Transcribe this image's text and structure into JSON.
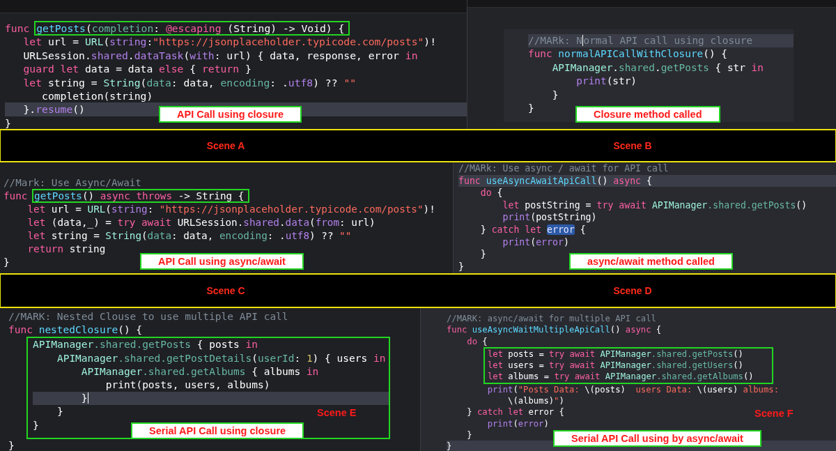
{
  "rows": [
    {
      "kind": "code",
      "panels": [
        {
          "lines": [
            {
              "kind": "line",
              "current": false,
              "tokens": [
                {
                  "text": "func ",
                  "kind": "kw"
                },
                {
                  "kind": "outlined",
                  "tokens": [
                    {
                      "text": "getPosts",
                      "kind": "decl"
                    },
                    {
                      "text": "(",
                      "kind": "plain"
                    },
                    {
                      "text": "completion",
                      "kind": "member"
                    },
                    {
                      "text": ": ",
                      "kind": "plain"
                    },
                    {
                      "text": "@escaping",
                      "kind": "kw"
                    },
                    {
                      "text": " (String) -> Void) {",
                      "kind": "plain"
                    }
                  ]
                }
              ]
            },
            {
              "kind": "line",
              "current": false,
              "tokens": [
                {
                  "text": "   let",
                  "kind": "kw"
                },
                {
                  "text": " url = ",
                  "kind": "plain"
                },
                {
                  "text": "URL",
                  "kind": "type"
                },
                {
                  "text": "(",
                  "kind": "plain"
                },
                {
                  "text": "string",
                  "kind": "sys"
                },
                {
                  "text": ":",
                  "kind": "plain"
                },
                {
                  "text": "\"https://jsonplaceholder.typicode.com/posts\"",
                  "kind": "str"
                },
                {
                  "text": ")!",
                  "kind": "plain"
                }
              ]
            },
            {
              "kind": "line",
              "current": false,
              "tokens": [
                {
                  "text": "   URLSession.",
                  "kind": "plain"
                },
                {
                  "text": "shared",
                  "kind": "sys"
                },
                {
                  "text": ".",
                  "kind": "plain"
                },
                {
                  "text": "dataTask",
                  "kind": "sys"
                },
                {
                  "text": "(",
                  "kind": "plain"
                },
                {
                  "text": "with",
                  "kind": "sys"
                },
                {
                  "text": ": url) { data, response, error ",
                  "kind": "plain"
                },
                {
                  "text": "in",
                  "kind": "kw"
                }
              ]
            },
            {
              "kind": "line",
              "current": false,
              "tokens": [
                {
                  "text": "   guard let",
                  "kind": "kw"
                },
                {
                  "text": " data = data ",
                  "kind": "plain"
                },
                {
                  "text": "else",
                  "kind": "kw"
                },
                {
                  "text": " { ",
                  "kind": "plain"
                },
                {
                  "text": "return",
                  "kind": "kw"
                },
                {
                  "text": " }",
                  "kind": "plain"
                }
              ]
            },
            {
              "kind": "line",
              "current": false,
              "tokens": [
                {
                  "text": "   let",
                  "kind": "kw"
                },
                {
                  "text": " string = ",
                  "kind": "plain"
                },
                {
                  "text": "String",
                  "kind": "type"
                },
                {
                  "text": "(",
                  "kind": "plain"
                },
                {
                  "text": "data",
                  "kind": "member"
                },
                {
                  "text": ": data, ",
                  "kind": "plain"
                },
                {
                  "text": "encoding",
                  "kind": "member"
                },
                {
                  "text": ": .",
                  "kind": "plain"
                },
                {
                  "text": "utf8",
                  "kind": "sys"
                },
                {
                  "text": ") ?? ",
                  "kind": "plain"
                },
                {
                  "text": "\"\"",
                  "kind": "str"
                }
              ]
            },
            {
              "kind": "line",
              "current": false,
              "tokens": [
                {
                  "text": "      completion(string)",
                  "kind": "plain"
                }
              ]
            },
            {
              "kind": "line",
              "current": true,
              "tokens": [
                {
                  "text": "   }.",
                  "kind": "plain"
                },
                {
                  "text": "resume",
                  "kind": "sys"
                },
                {
                  "text": "()",
                  "kind": "plain"
                }
              ]
            },
            {
              "kind": "line",
              "current": false,
              "tokens": [
                {
                  "text": "}",
                  "kind": "plain"
                }
              ]
            }
          ],
          "caption": "API Call using closure"
        },
        {
          "lines": [
            {
              "kind": "line",
              "current": true,
              "tokens": [
                {
                  "text": "//MARk: N",
                  "kind": "comment"
                },
                {
                  "kind": "caret"
                },
                {
                  "text": "ormal API call using closure",
                  "kind": "comment"
                }
              ]
            },
            {
              "kind": "line",
              "current": false,
              "tokens": [
                {
                  "text": "func ",
                  "kind": "kw"
                },
                {
                  "text": "normalAPICallWithClosure",
                  "kind": "decl"
                },
                {
                  "text": "() {",
                  "kind": "plain"
                }
              ]
            },
            {
              "kind": "line",
              "current": false,
              "tokens": [
                {
                  "text": "    APIManager",
                  "kind": "type"
                },
                {
                  "text": ".",
                  "kind": "plain"
                },
                {
                  "text": "shared",
                  "kind": "member"
                },
                {
                  "text": ".",
                  "kind": "plain"
                },
                {
                  "text": "getPosts",
                  "kind": "member"
                },
                {
                  "text": " { str ",
                  "kind": "plain"
                },
                {
                  "text": "in",
                  "kind": "kw"
                }
              ]
            },
            {
              "kind": "line",
              "current": false,
              "tokens": [
                {
                  "text": "        print",
                  "kind": "sys"
                },
                {
                  "text": "(str)",
                  "kind": "plain"
                }
              ]
            },
            {
              "kind": "line",
              "current": false,
              "tokens": [
                {
                  "text": "    }",
                  "kind": "plain"
                }
              ]
            },
            {
              "kind": "line",
              "current": false,
              "tokens": [
                {
                  "text": "}",
                  "kind": "plain"
                }
              ]
            }
          ],
          "caption": "Closure method called"
        }
      ]
    },
    {
      "kind": "banner",
      "labels": [
        "Scene A",
        "Scene B"
      ]
    },
    {
      "kind": "code",
      "panels": [
        {
          "lines": [
            {
              "kind": "line",
              "current": false,
              "tokens": [
                {
                  "text": "//Mark: Use Async/Await",
                  "kind": "comment"
                }
              ]
            },
            {
              "kind": "line",
              "current": false,
              "tokens": [
                {
                  "text": "func ",
                  "kind": "kw"
                },
                {
                  "kind": "outlined",
                  "tokens": [
                    {
                      "text": "getPosts",
                      "kind": "decl"
                    },
                    {
                      "text": "() ",
                      "kind": "plain"
                    },
                    {
                      "text": "async throws",
                      "kind": "kw"
                    },
                    {
                      "text": " -> String {",
                      "kind": "plain"
                    }
                  ]
                }
              ]
            },
            {
              "kind": "line",
              "current": false,
              "tokens": [
                {
                  "text": "    let",
                  "kind": "kw"
                },
                {
                  "text": " url = ",
                  "kind": "plain"
                },
                {
                  "text": "URL",
                  "kind": "type"
                },
                {
                  "text": "(",
                  "kind": "plain"
                },
                {
                  "text": "string",
                  "kind": "sys"
                },
                {
                  "text": ": ",
                  "kind": "plain"
                },
                {
                  "text": "\"https://jsonplaceholder.typicode.com/posts\"",
                  "kind": "str"
                },
                {
                  "text": ")!",
                  "kind": "plain"
                }
              ]
            },
            {
              "kind": "line",
              "current": false,
              "tokens": [
                {
                  "text": "    let",
                  "kind": "kw"
                },
                {
                  "text": " (data,_) = ",
                  "kind": "plain"
                },
                {
                  "text": "try await",
                  "kind": "kw"
                },
                {
                  "text": " URLSession.",
                  "kind": "plain"
                },
                {
                  "text": "shared",
                  "kind": "sys"
                },
                {
                  "text": ".",
                  "kind": "plain"
                },
                {
                  "text": "data",
                  "kind": "sys"
                },
                {
                  "text": "(",
                  "kind": "plain"
                },
                {
                  "text": "from",
                  "kind": "sys"
                },
                {
                  "text": ": url)",
                  "kind": "plain"
                }
              ]
            },
            {
              "kind": "line",
              "current": false,
              "tokens": [
                {
                  "text": "    let",
                  "kind": "kw"
                },
                {
                  "text": " string = ",
                  "kind": "plain"
                },
                {
                  "text": "String",
                  "kind": "type"
                },
                {
                  "text": "(",
                  "kind": "plain"
                },
                {
                  "text": "data",
                  "kind": "member"
                },
                {
                  "text": ": data, ",
                  "kind": "plain"
                },
                {
                  "text": "encoding",
                  "kind": "member"
                },
                {
                  "text": ": .",
                  "kind": "plain"
                },
                {
                  "text": "utf8",
                  "kind": "sys"
                },
                {
                  "text": ") ?? ",
                  "kind": "plain"
                },
                {
                  "text": "\"\"",
                  "kind": "str"
                }
              ]
            },
            {
              "kind": "line",
              "current": false,
              "tokens": [
                {
                  "text": "    return",
                  "kind": "kw"
                },
                {
                  "text": " string",
                  "kind": "plain"
                }
              ]
            },
            {
              "kind": "line",
              "current": false,
              "tokens": [
                {
                  "text": "}",
                  "kind": "plain"
                }
              ]
            }
          ],
          "caption": "API Call using async/await"
        },
        {
          "lines": [
            {
              "kind": "line",
              "current": false,
              "tokens": [
                {
                  "text": "//MARk: Use async / await for API call",
                  "kind": "comment"
                }
              ]
            },
            {
              "kind": "line",
              "current": true,
              "tokens": [
                {
                  "text": "func ",
                  "kind": "kw"
                },
                {
                  "text": "useAsyncAwaitApiCall",
                  "kind": "decl"
                },
                {
                  "text": "() ",
                  "kind": "plain"
                },
                {
                  "text": "async",
                  "kind": "kw"
                },
                {
                  "text": " {",
                  "kind": "plain"
                }
              ]
            },
            {
              "kind": "line",
              "current": false,
              "tokens": [
                {
                  "text": "    do",
                  "kind": "kw"
                },
                {
                  "text": " {",
                  "kind": "plain"
                }
              ]
            },
            {
              "kind": "line",
              "current": false,
              "tokens": [
                {
                  "text": "        let",
                  "kind": "kw"
                },
                {
                  "text": " postString = ",
                  "kind": "plain"
                },
                {
                  "text": "try await",
                  "kind": "kw"
                },
                {
                  "text": " APIManager",
                  "kind": "type"
                },
                {
                  "text": ".shared",
                  "kind": "member"
                },
                {
                  "text": ".getPosts",
                  "kind": "member"
                },
                {
                  "text": "()",
                  "kind": "plain"
                }
              ]
            },
            {
              "kind": "line",
              "current": false,
              "tokens": [
                {
                  "text": "        print",
                  "kind": "sys"
                },
                {
                  "text": "(postString)",
                  "kind": "plain"
                }
              ]
            },
            {
              "kind": "line",
              "current": false,
              "tokens": [
                {
                  "text": "    } ",
                  "kind": "plain"
                },
                {
                  "text": "catch let ",
                  "kind": "kw"
                },
                {
                  "text": "error",
                  "kind": "sel"
                },
                {
                  "text": " {",
                  "kind": "plain"
                }
              ]
            },
            {
              "kind": "line",
              "current": false,
              "tokens": [
                {
                  "text": "        print",
                  "kind": "sys"
                },
                {
                  "text": "(",
                  "kind": "plain"
                },
                {
                  "text": "error",
                  "kind": "sys"
                },
                {
                  "text": ")",
                  "kind": "plain"
                }
              ]
            },
            {
              "kind": "line",
              "current": false,
              "tokens": [
                {
                  "text": "    }",
                  "kind": "plain"
                }
              ]
            },
            {
              "kind": "line",
              "current": false,
              "tokens": [
                {
                  "text": "}",
                  "kind": "plain"
                }
              ]
            }
          ],
          "caption": "async/await method called"
        }
      ]
    },
    {
      "kind": "banner",
      "labels": [
        "Scene C",
        "Scene D"
      ]
    },
    {
      "kind": "code",
      "panels": [
        {
          "lines": [
            {
              "kind": "line",
              "current": false,
              "tokens": [
                {
                  "text": "//MARK: Nested Clouse to use multiple API call",
                  "kind": "comment"
                }
              ]
            },
            {
              "kind": "line",
              "current": false,
              "tokens": [
                {
                  "text": "func ",
                  "kind": "kw"
                },
                {
                  "text": "nestedClosure",
                  "kind": "decl"
                },
                {
                  "text": "() {",
                  "kind": "plain"
                }
              ]
            },
            {
              "kind": "outlined-block",
              "lines": [
                {
                  "kind": "line",
                  "current": false,
                  "tokens": [
                    {
                      "text": "APIManager",
                      "kind": "type"
                    },
                    {
                      "text": ".shared",
                      "kind": "member"
                    },
                    {
                      "text": ".getPosts",
                      "kind": "member"
                    },
                    {
                      "text": " { posts ",
                      "kind": "plain"
                    },
                    {
                      "text": "in",
                      "kind": "kw"
                    }
                  ]
                },
                {
                  "kind": "line",
                  "current": false,
                  "tokens": [
                    {
                      "text": "    APIManager",
                      "kind": "type"
                    },
                    {
                      "text": ".shared",
                      "kind": "member"
                    },
                    {
                      "text": ".getPostDetails",
                      "kind": "member"
                    },
                    {
                      "text": "(",
                      "kind": "plain"
                    },
                    {
                      "text": "userId",
                      "kind": "member"
                    },
                    {
                      "text": ": ",
                      "kind": "plain"
                    },
                    {
                      "text": "1",
                      "kind": "num"
                    },
                    {
                      "text": ") { users ",
                      "kind": "plain"
                    },
                    {
                      "text": "in",
                      "kind": "kw"
                    }
                  ]
                },
                {
                  "kind": "line",
                  "current": false,
                  "tokens": [
                    {
                      "text": "        APIManager",
                      "kind": "type"
                    },
                    {
                      "text": ".shared",
                      "kind": "member"
                    },
                    {
                      "text": ".getAlbums",
                      "kind": "member"
                    },
                    {
                      "text": " { albums ",
                      "kind": "plain"
                    },
                    {
                      "text": "in",
                      "kind": "kw"
                    }
                  ]
                },
                {
                  "kind": "line",
                  "current": false,
                  "tokens": [
                    {
                      "text": "            print(posts, users, albums)",
                      "kind": "plain"
                    }
                  ]
                },
                {
                  "kind": "line",
                  "current": true,
                  "tokens": [
                    {
                      "text": "        }",
                      "kind": "plain"
                    },
                    {
                      "kind": "caret"
                    }
                  ]
                },
                {
                  "kind": "line",
                  "current": false,
                  "tokens": [
                    {
                      "text": "    }",
                      "kind": "plain"
                    }
                  ]
                },
                {
                  "kind": "line",
                  "current": false,
                  "tokens": [
                    {
                      "text": "}",
                      "kind": "plain"
                    }
                  ]
                }
              ]
            },
            {
              "kind": "line",
              "current": false,
              "tokens": [
                {
                  "text": "}",
                  "kind": "plain"
                }
              ]
            }
          ],
          "caption": "Serial API Call using closure",
          "scene_label": "Scene E"
        },
        {
          "lines": [
            {
              "kind": "line",
              "current": false,
              "tokens": [
                {
                  "text": "//MARK: async/await for multiple API call",
                  "kind": "comment"
                }
              ]
            },
            {
              "kind": "line",
              "current": false,
              "tokens": [
                {
                  "text": "func ",
                  "kind": "kw"
                },
                {
                  "text": "useAsyncWaitMultipleApiCall",
                  "kind": "decl"
                },
                {
                  "text": "() ",
                  "kind": "plain"
                },
                {
                  "text": "async",
                  "kind": "kw"
                },
                {
                  "text": " {",
                  "kind": "plain"
                }
              ]
            },
            {
              "kind": "line",
              "current": false,
              "tokens": [
                {
                  "text": "    do",
                  "kind": "kw"
                },
                {
                  "text": " {",
                  "kind": "plain"
                }
              ]
            },
            {
              "kind": "outlined-block",
              "lines": [
                {
                  "kind": "line",
                  "current": false,
                  "tokens": [
                    {
                      "text": "let",
                      "kind": "kw"
                    },
                    {
                      "text": " posts = ",
                      "kind": "plain"
                    },
                    {
                      "text": "try await",
                      "kind": "kw"
                    },
                    {
                      "text": " APIManager",
                      "kind": "type"
                    },
                    {
                      "text": ".shared",
                      "kind": "member"
                    },
                    {
                      "text": ".getPosts",
                      "kind": "member"
                    },
                    {
                      "text": "()",
                      "kind": "plain"
                    }
                  ]
                },
                {
                  "kind": "line",
                  "current": false,
                  "tokens": [
                    {
                      "text": "let",
                      "kind": "kw"
                    },
                    {
                      "text": " users = ",
                      "kind": "plain"
                    },
                    {
                      "text": "try await",
                      "kind": "kw"
                    },
                    {
                      "text": " APIManager",
                      "kind": "type"
                    },
                    {
                      "text": ".shared",
                      "kind": "member"
                    },
                    {
                      "text": ".getUsers",
                      "kind": "member"
                    },
                    {
                      "text": "()",
                      "kind": "plain"
                    }
                  ]
                },
                {
                  "kind": "line",
                  "current": false,
                  "tokens": [
                    {
                      "text": "let",
                      "kind": "kw"
                    },
                    {
                      "text": " albums = ",
                      "kind": "plain"
                    },
                    {
                      "text": "try await",
                      "kind": "kw"
                    },
                    {
                      "text": " APIManager",
                      "kind": "type"
                    },
                    {
                      "text": ".shared",
                      "kind": "member"
                    },
                    {
                      "text": ".getAlbums",
                      "kind": "member"
                    },
                    {
                      "text": "()",
                      "kind": "plain"
                    }
                  ]
                }
              ]
            },
            {
              "kind": "line",
              "current": false,
              "tokens": [
                {
                  "text": "        print",
                  "kind": "sys"
                },
                {
                  "text": "(",
                  "kind": "plain"
                },
                {
                  "text": "\"Posts Data: ",
                  "kind": "str"
                },
                {
                  "text": "\\(posts)",
                  "kind": "plain"
                },
                {
                  "text": "  users Data: ",
                  "kind": "str"
                },
                {
                  "text": "\\(users)",
                  "kind": "plain"
                },
                {
                  "text": " albums:",
                  "kind": "str"
                }
              ]
            },
            {
              "kind": "line",
              "current": false,
              "tokens": [
                {
                  "text": "            \\(albums)",
                  "kind": "plain"
                },
                {
                  "text": "\"",
                  "kind": "str"
                },
                {
                  "text": ")",
                  "kind": "plain"
                }
              ]
            },
            {
              "kind": "line",
              "current": false,
              "tokens": [
                {
                  "text": "    } ",
                  "kind": "plain"
                },
                {
                  "text": "catch let",
                  "kind": "kw"
                },
                {
                  "text": " error {",
                  "kind": "plain"
                }
              ]
            },
            {
              "kind": "line",
              "current": false,
              "tokens": [
                {
                  "text": "        print",
                  "kind": "sys"
                },
                {
                  "text": "(",
                  "kind": "plain"
                },
                {
                  "text": "error",
                  "kind": "sys"
                },
                {
                  "text": ")",
                  "kind": "plain"
                }
              ]
            },
            {
              "kind": "line",
              "current": false,
              "tokens": [
                {
                  "text": "    }",
                  "kind": "plain"
                }
              ]
            },
            {
              "kind": "line",
              "current": true,
              "tokens": [
                {
                  "text": "}",
                  "kind": "plain"
                }
              ]
            }
          ],
          "caption": "Serial API Call using by async/await",
          "scene_label": "Scene F"
        }
      ]
    }
  ]
}
